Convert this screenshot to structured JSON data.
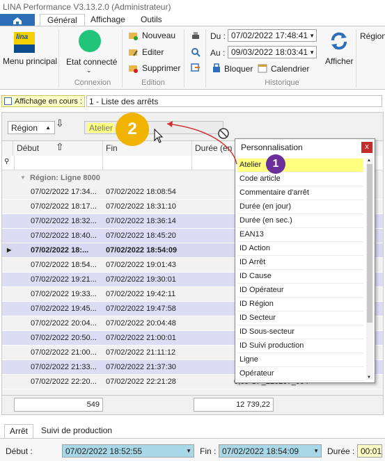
{
  "window": {
    "title": "LINA Performance  V3.13.2.0  (Administrateur)"
  },
  "ribbon": {
    "tabs": [
      "Général",
      "Affichage",
      "Outils"
    ],
    "menu_principal": {
      "label": "Menu principal",
      "logo_text": "lina"
    },
    "connexion": {
      "state": "Etat connecté",
      "group": "Connexion",
      "status_color": "#22c47a"
    },
    "edition": {
      "nouveau": "Nouveau",
      "editer": "Editer",
      "supprimer": "Supprimer",
      "group": "Edition"
    },
    "historique": {
      "du_label": "Du :",
      "du_value": "07/02/2022 17:48:41",
      "au_label": "Au :",
      "au_value": "09/03/2022 18:03:41",
      "bloquer": "Bloquer",
      "calendrier": "Calendrier",
      "afficher": "Afficher",
      "region": "Région",
      "group": "Historique"
    }
  },
  "affichage": {
    "button": "Affichage en cours :",
    "value": "1 - Liste des arrêts"
  },
  "grid": {
    "group_chips": {
      "region": "Région",
      "atelier": "Atelier"
    },
    "columns": {
      "debut": "Début",
      "fin": "Fin",
      "duree": "Durée (en m"
    },
    "group_row": "Région: Ligne 8000",
    "rows": [
      {
        "debut": "07/02/2022 17:34...",
        "fin": "07/02/2022 18:08:54",
        "extra": "re"
      },
      {
        "debut": "07/02/2022 18:17...",
        "fin": "07/02/2022 18:31:10",
        "extra": "nc"
      },
      {
        "debut": "07/02/2022 18:32...",
        "fin": "07/02/2022 18:36:14",
        "extra": ""
      },
      {
        "debut": "07/02/2022 18:40...",
        "fin": "07/02/2022 18:45:20",
        "extra": ""
      },
      {
        "debut": "07/02/2022 18:...",
        "fin": "07/02/2022 18:54:09",
        "extra": ""
      },
      {
        "debut": "07/02/2022 18:54...",
        "fin": "07/02/2022 19:01:43",
        "extra": "nc"
      },
      {
        "debut": "07/02/2022 19:21...",
        "fin": "07/02/2022 19:30:01",
        "extra": "nc"
      },
      {
        "debut": "07/02/2022 19:33...",
        "fin": "07/02/2022 19:42:11",
        "extra": "nc"
      },
      {
        "debut": "07/02/2022 19:45...",
        "fin": "07/02/2022 19:47:58",
        "extra": ""
      },
      {
        "debut": "07/02/2022 20:04...",
        "fin": "07/02/2022 20:04:48",
        "extra": ""
      },
      {
        "debut": "07/02/2022 20:50...",
        "fin": "07/02/2022 21:00:01",
        "extra": "pr"
      },
      {
        "debut": "07/02/2022 21:00...",
        "fin": "07/02/2022 21:11:12",
        "extra": "nc"
      },
      {
        "debut": "07/02/2022 21:33...",
        "fin": "07/02/2022 21:37:30",
        "extra": ""
      },
      {
        "debut": "07/02/2022 22:20...",
        "fin": "07/02/2022 22:21:28",
        "extra": "0,69  OF_220207_004"
      }
    ],
    "totals": {
      "count": "549",
      "duree": "12 739,22"
    }
  },
  "popup": {
    "title": "Personnalisation",
    "items": [
      "Atelier",
      "Code article",
      "Commentaire d'arrêt",
      "Durée (en jour)",
      "Durée (en sec.)",
      "EAN13",
      "ID Action",
      "ID Arrêt",
      "ID Cause",
      "ID Opérateur",
      "ID Région",
      "ID Secteur",
      "ID Sous-secteur",
      "ID Suivi production",
      "Ligne",
      "Opérateur"
    ]
  },
  "annotations": {
    "badge1": "1",
    "badge2": "2",
    "badge1_color": "#6a2f9a",
    "badge2_color": "#f0b400"
  },
  "bottom": {
    "tabs": [
      "Arrêt",
      "Suivi de production"
    ],
    "debut_label": "Début :",
    "debut_value": "07/02/2022 18:52:55",
    "fin_label": "Fin :",
    "fin_value": "07/02/2022 18:54:09",
    "duree_label": "Durée :",
    "duree_value": "00:01"
  }
}
